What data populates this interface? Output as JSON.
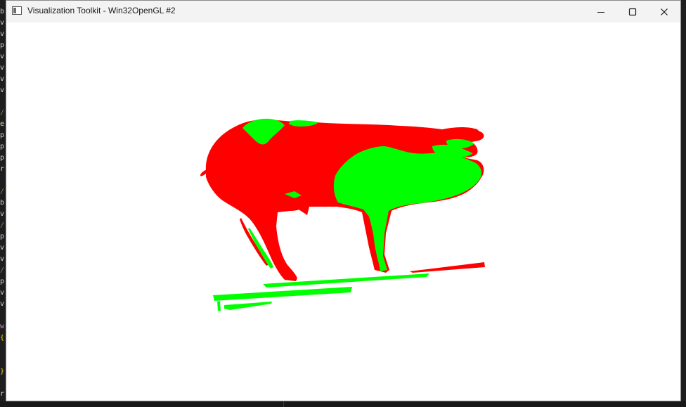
{
  "window": {
    "title": "Visualization Toolkit - Win32OpenGL #2",
    "icon": "vtk-window-icon",
    "controls": {
      "minimize_icon": "minimize-icon",
      "maximize_icon": "maximize-icon",
      "close_icon": "close-icon"
    }
  },
  "viewport": {
    "background": "#ffffff",
    "colors": {
      "segment_a": "#ff0000",
      "segment_b": "#00ff00"
    }
  },
  "editor_glyphs": [
    "b",
    "v",
    "v",
    "p",
    "v",
    "v",
    "v",
    "v",
    "",
    "/",
    "e",
    "p",
    "p",
    "p",
    "r",
    "",
    "/",
    "b",
    "v",
    "/",
    "p",
    "v",
    "v",
    "/",
    "p",
    "v",
    "v",
    "",
    "w",
    "{",
    "",
    "",
    "}",
    "",
    "r"
  ]
}
